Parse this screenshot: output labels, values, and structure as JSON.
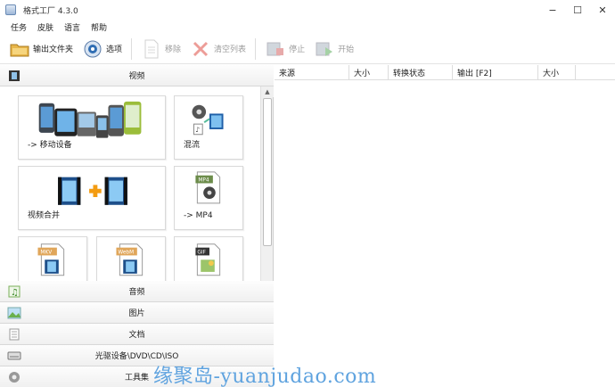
{
  "window": {
    "title": "格式工厂 4.3.0",
    "min": "−",
    "max": "☐",
    "close": "✕"
  },
  "menu": [
    "任务",
    "皮肤",
    "语言",
    "帮助"
  ],
  "toolbar": {
    "output_folder": "输出文件夹",
    "options": "选项",
    "remove": "移除",
    "clear_list": "清空列表",
    "stop": "停止",
    "start": "开始"
  },
  "categories": {
    "video": "视频",
    "audio": "音频",
    "picture": "图片",
    "document": "文档",
    "rom": "光驱设备\\DVD\\CD\\ISO",
    "tools": "工具集"
  },
  "tiles": {
    "mobile": "-> 移动设备",
    "mix": "混流",
    "join": "视频合并",
    "mp4": "-> MP4",
    "mp4_tag": "MP4",
    "mkv_tag": "MKV",
    "webm_tag": "WebM",
    "gif_tag": "GIF"
  },
  "columns": [
    "来源",
    "大小",
    "转换状态",
    "输出 [F2]",
    "大小"
  ],
  "watermark": "缘聚岛-yuanjudao.com"
}
